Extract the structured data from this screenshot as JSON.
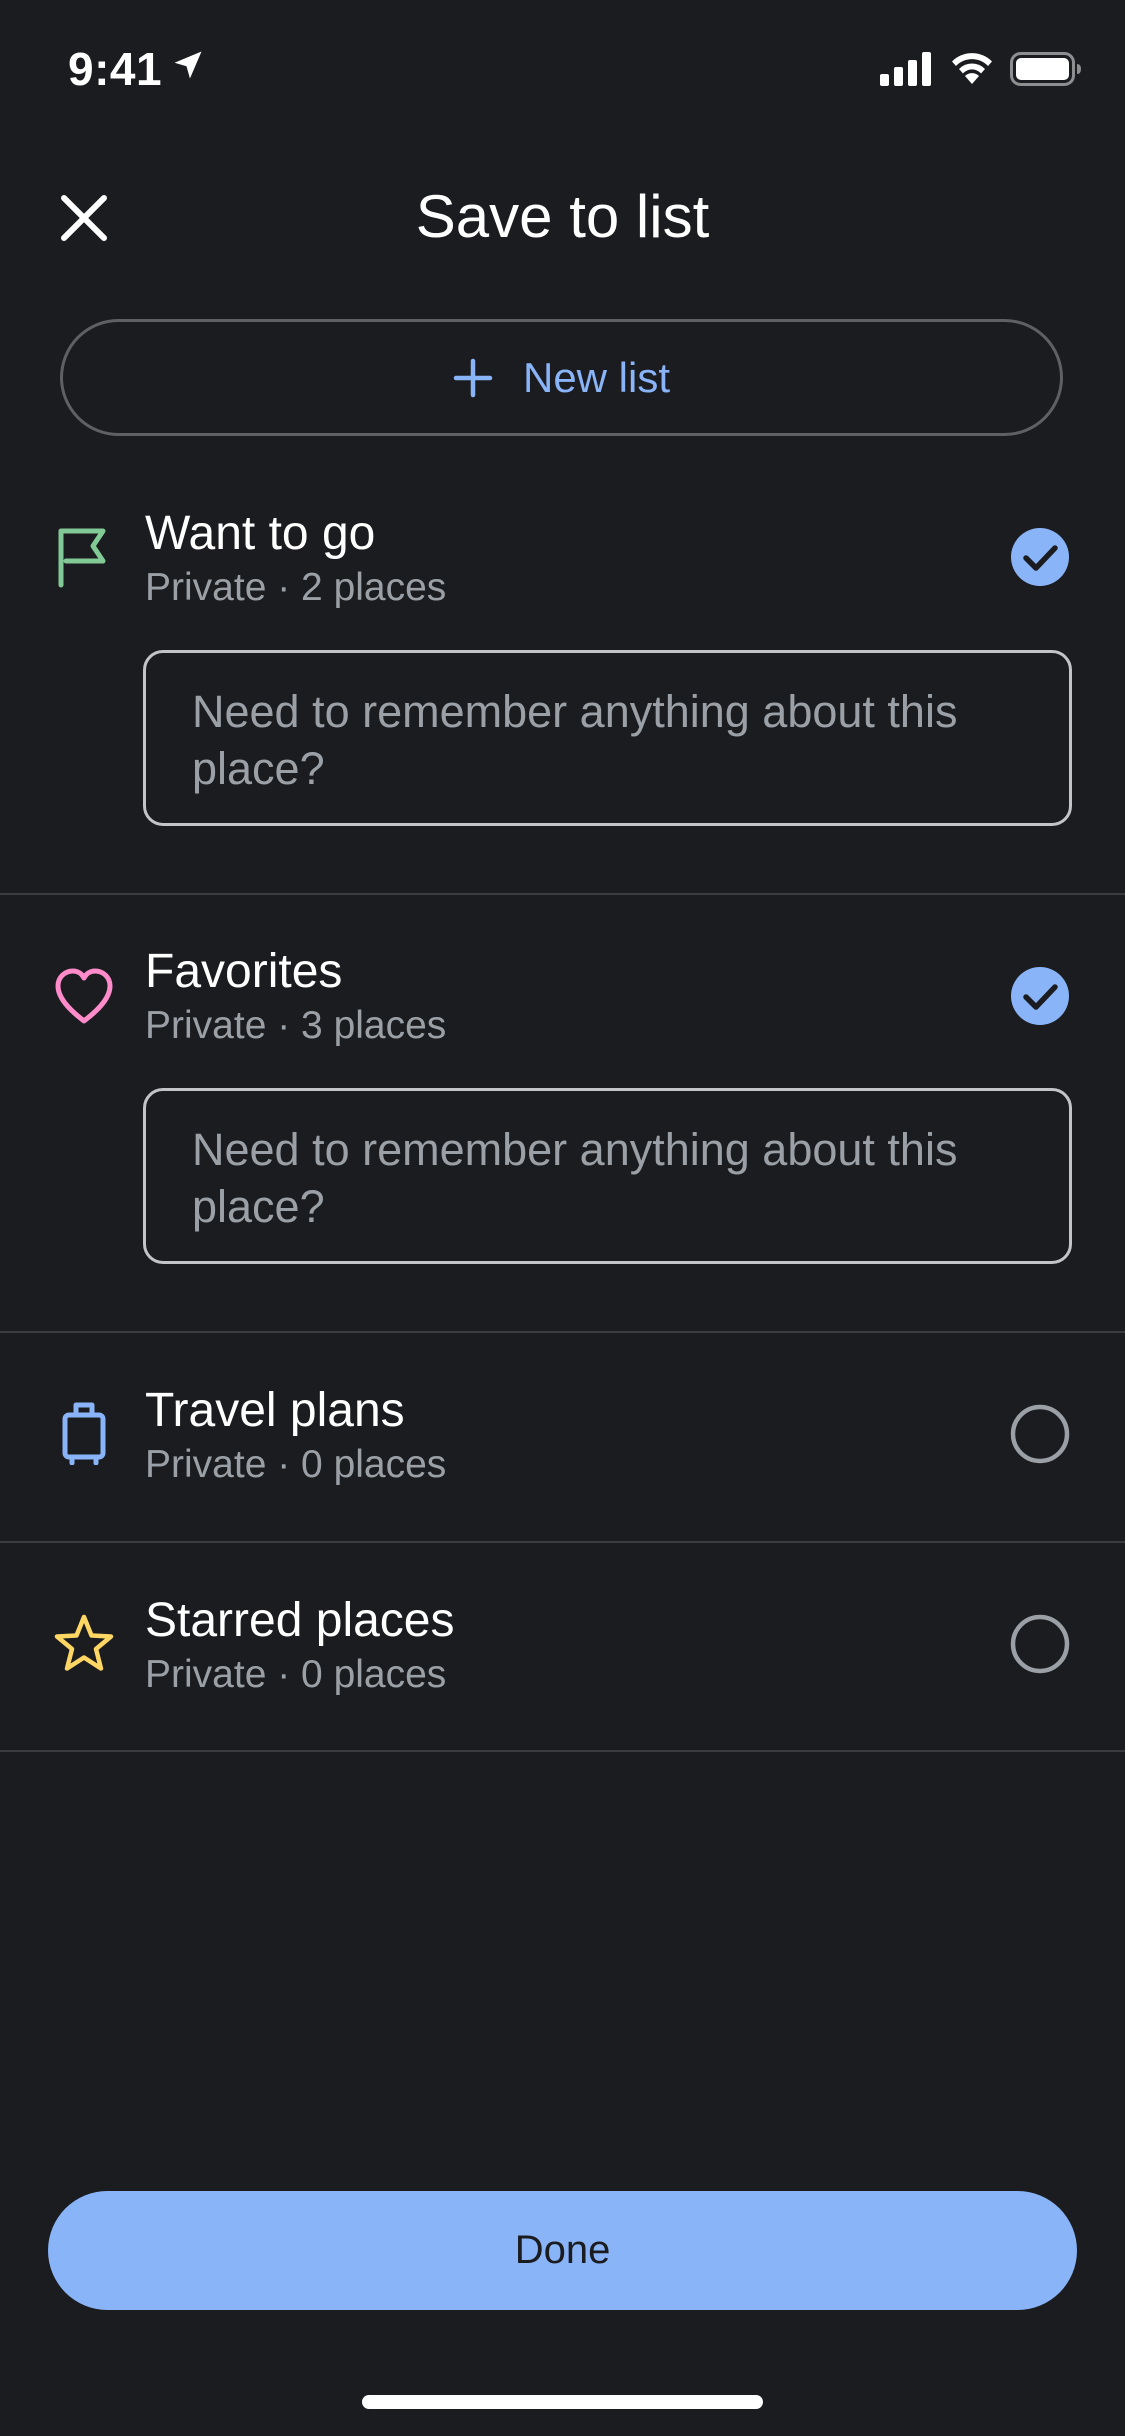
{
  "status_bar": {
    "time": "9:41"
  },
  "header": {
    "title": "Save to list"
  },
  "new_list": {
    "label": "New list"
  },
  "lists": [
    {
      "name": "Want to go",
      "meta": "Private · 2 places",
      "icon": "flag-icon",
      "icon_color": "#81c995",
      "checked": true,
      "note_placeholder": "Need to remember anything about this place?"
    },
    {
      "name": "Favorites",
      "meta": "Private · 3 places",
      "icon": "heart-icon",
      "icon_color": "#ff8bcb",
      "checked": true,
      "note_placeholder": "Need to remember anything about this place?"
    },
    {
      "name": "Travel plans",
      "meta": "Private · 0 places",
      "icon": "suitcase-icon",
      "icon_color": "#8ab4f8",
      "checked": false
    },
    {
      "name": "Starred places",
      "meta": "Private · 0 places",
      "icon": "star-icon",
      "icon_color": "#fdd663",
      "checked": false
    }
  ],
  "done": {
    "label": "Done"
  },
  "colors": {
    "background": "#1b1c20",
    "accent": "#8ab4f8",
    "secondary_text": "#9aa0a6"
  }
}
